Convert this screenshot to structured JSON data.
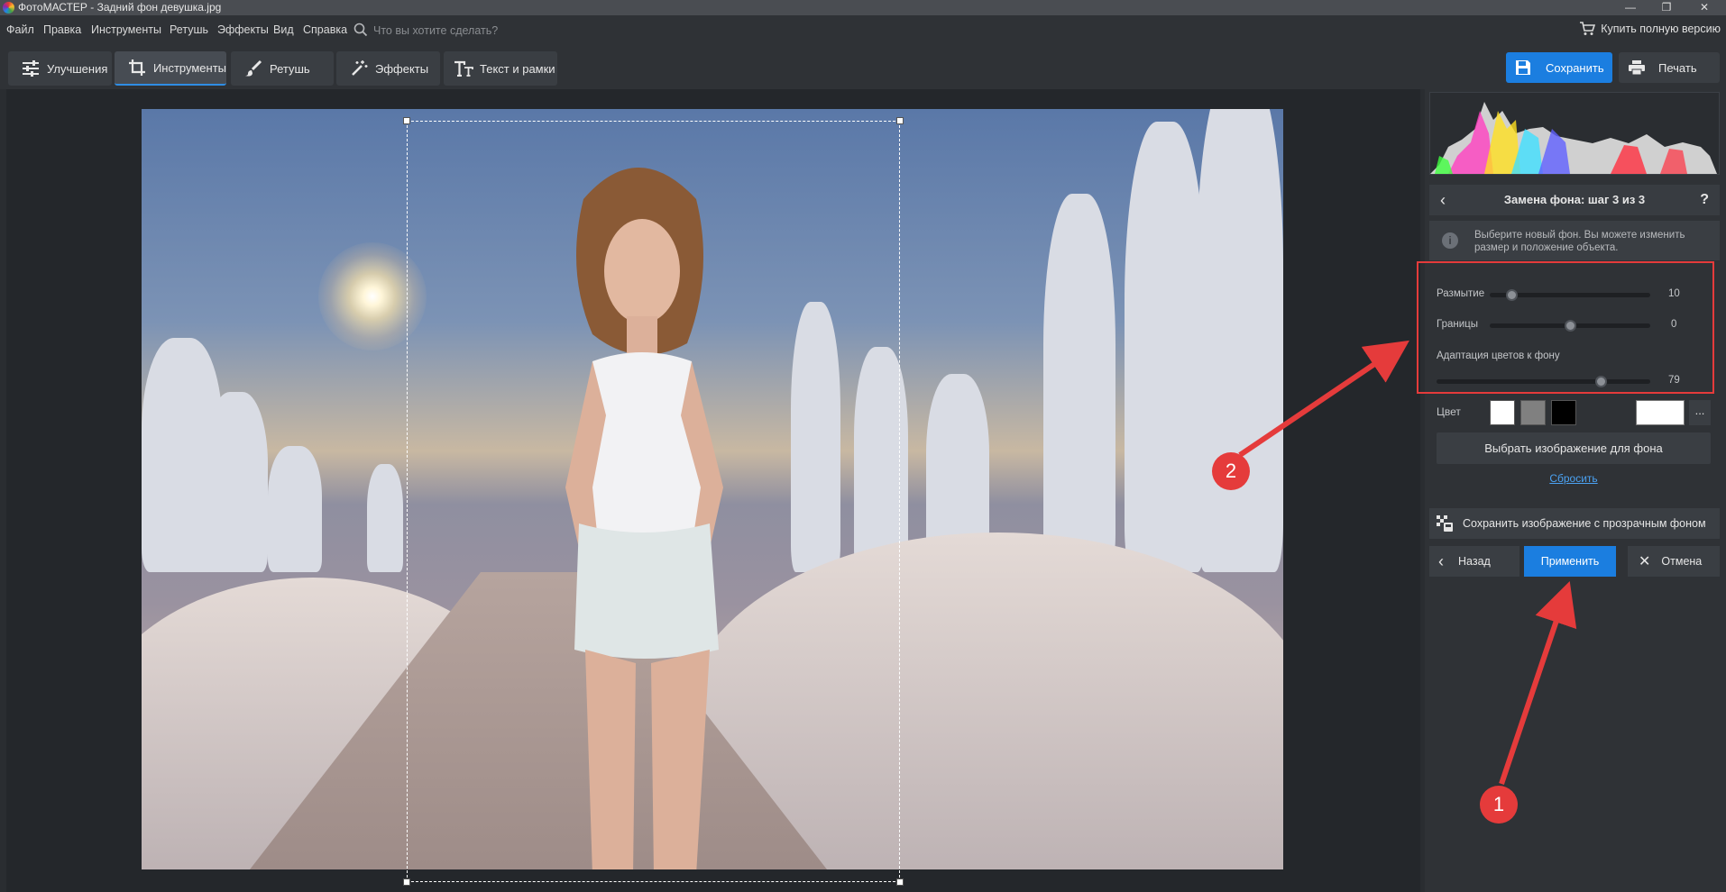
{
  "window": {
    "title": "ФотоМАСТЕР - Задний фон девушка.jpg",
    "controls": [
      "—",
      "❐",
      "✕"
    ]
  },
  "menu": {
    "items": [
      "Файл",
      "Правка",
      "Инструменты",
      "Ретушь",
      "Эффекты",
      "Вид",
      "Справка"
    ],
    "search_placeholder": "Что вы хотите сделать?",
    "buy_label": "Купить полную версию"
  },
  "toolbar": {
    "tabs": [
      {
        "label": "Улучшения",
        "icon": "sliders-icon"
      },
      {
        "label": "Инструменты",
        "icon": "crop-icon",
        "active": true
      },
      {
        "label": "Ретушь",
        "icon": "brush-icon"
      },
      {
        "label": "Эффекты",
        "icon": "magic-wand-icon"
      },
      {
        "label": "Текст и рамки",
        "icon": "text-icon"
      }
    ],
    "save_label": "Сохранить",
    "print_label": "Печать"
  },
  "panel": {
    "step_title": "Замена фона: шаг 3 из 3",
    "help": "?",
    "info_text": "Выберите новый фон. Вы можете изменить размер и положение объекта.",
    "sliders": [
      {
        "label": "Размытие",
        "value": "10",
        "fraction": 0.1
      },
      {
        "label": "Границы",
        "value": "0",
        "fraction": 0.5
      },
      {
        "label": "Адаптация цветов к фону",
        "value": "79",
        "fraction": 0.77
      }
    ],
    "color_label": "Цвет",
    "swatches": [
      "#ffffff",
      "#808080",
      "#000000"
    ],
    "more_label": "...",
    "choose_bg_label": "Выбрать изображение для фона",
    "reset_label": "Сбросить",
    "save_transparent_label": "Сохранить изображение с прозрачным фоном",
    "back_label": "Назад",
    "apply_label": "Применить",
    "cancel_label": "Отмена"
  },
  "annotations": {
    "marker_1": "1",
    "marker_2": "2",
    "color": "#e53b3b"
  },
  "colors": {
    "accent": "#1b7ee0",
    "link": "#4ba2f2"
  }
}
